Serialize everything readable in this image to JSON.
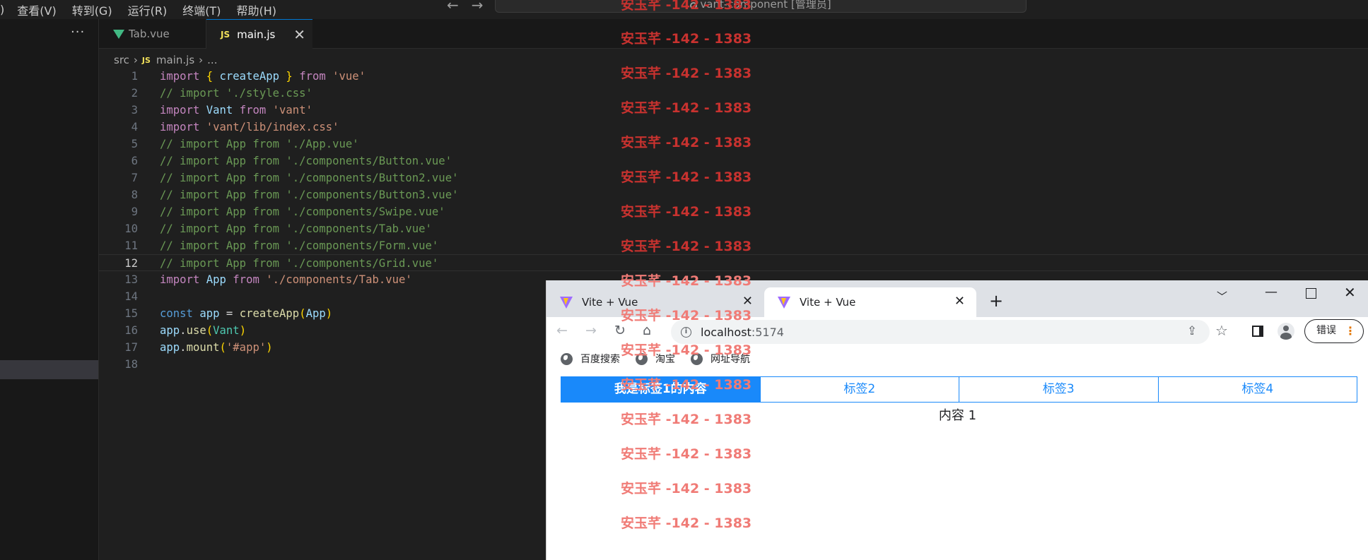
{
  "vscode": {
    "menu": [
      ")",
      "查看(V)",
      "转到(G)",
      "运行(R)",
      "终端(T)",
      "帮助(H)"
    ],
    "command_center": "vant-component [管理员]",
    "sidebar_more": "···",
    "tabs": [
      {
        "label": "Tab.vue",
        "icon": "vue-icon"
      },
      {
        "label": "main.js",
        "icon": "js-icon",
        "active": true
      }
    ],
    "js_badge": "JS",
    "tab_close": "✕",
    "breadcrumb": {
      "folder": "src",
      "file": "main.js",
      "symbol": "..."
    },
    "current_line": 12
  },
  "browser": {
    "tabs": [
      {
        "title": "Vite + Vue",
        "close": "✕"
      },
      {
        "title": "Vite + Vue",
        "close": "✕",
        "active": true
      }
    ],
    "new_tab": "+",
    "url_host": "localhost",
    "url_port": ":5174",
    "error_button": "错误",
    "bookmarks": [
      "百度搜索",
      "淘宝",
      "网址导航"
    ],
    "vant_tabs": [
      {
        "label": "我是标签1的内容",
        "active": true
      },
      {
        "label": "标签2"
      },
      {
        "label": "标签3"
      },
      {
        "label": "标签4"
      }
    ],
    "panel_content": "内容 1"
  },
  "watermark": {
    "text": "安玉芊 -142 - 1383",
    "colors": {
      "dark": "#c8322f",
      "light": "#f07b76"
    }
  },
  "colors": {
    "vscode_bg": "#1f1f1f",
    "vant_primary": "#1989fa",
    "keyword": "#c586c0",
    "string": "#ce9178",
    "comment": "#6a9955"
  }
}
